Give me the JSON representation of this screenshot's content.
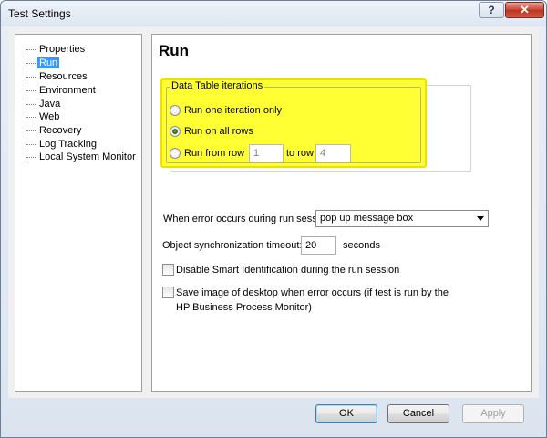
{
  "window": {
    "title": "Test Settings",
    "help_label": "?",
    "close_label": "✕"
  },
  "sidebar": {
    "items": [
      {
        "label": "Properties",
        "selected": false
      },
      {
        "label": "Run",
        "selected": true
      },
      {
        "label": "Resources",
        "selected": false
      },
      {
        "label": "Environment",
        "selected": false
      },
      {
        "label": "Java",
        "selected": false
      },
      {
        "label": "Web",
        "selected": false
      },
      {
        "label": "Recovery",
        "selected": false
      },
      {
        "label": "Log Tracking",
        "selected": false
      },
      {
        "label": "Local System Monitor",
        "selected": false
      }
    ]
  },
  "main": {
    "title": "Run",
    "iterations": {
      "legend": "Data Table iterations",
      "option_one": "Run one iteration only",
      "option_all": "Run on all rows",
      "option_range": "Run from row",
      "from_value": "1",
      "to_label": "to row",
      "to_value": "4",
      "selected": "option_all"
    },
    "error_label": "When error occurs during run session:",
    "error_value": "pop up message box",
    "sync_label": "Object synchronization timeout:",
    "sync_value": "20",
    "sync_unit": "seconds",
    "smart_id_label": "Disable Smart Identification during the run session",
    "save_image_line1": "Save image of desktop when error occurs (if test is run by the",
    "save_image_line2": "HP Business Process Monitor)"
  },
  "buttons": {
    "ok": "OK",
    "cancel": "Cancel",
    "apply": "Apply"
  },
  "colors": {
    "highlight": "#ffff33",
    "selection": "#3399ff"
  }
}
